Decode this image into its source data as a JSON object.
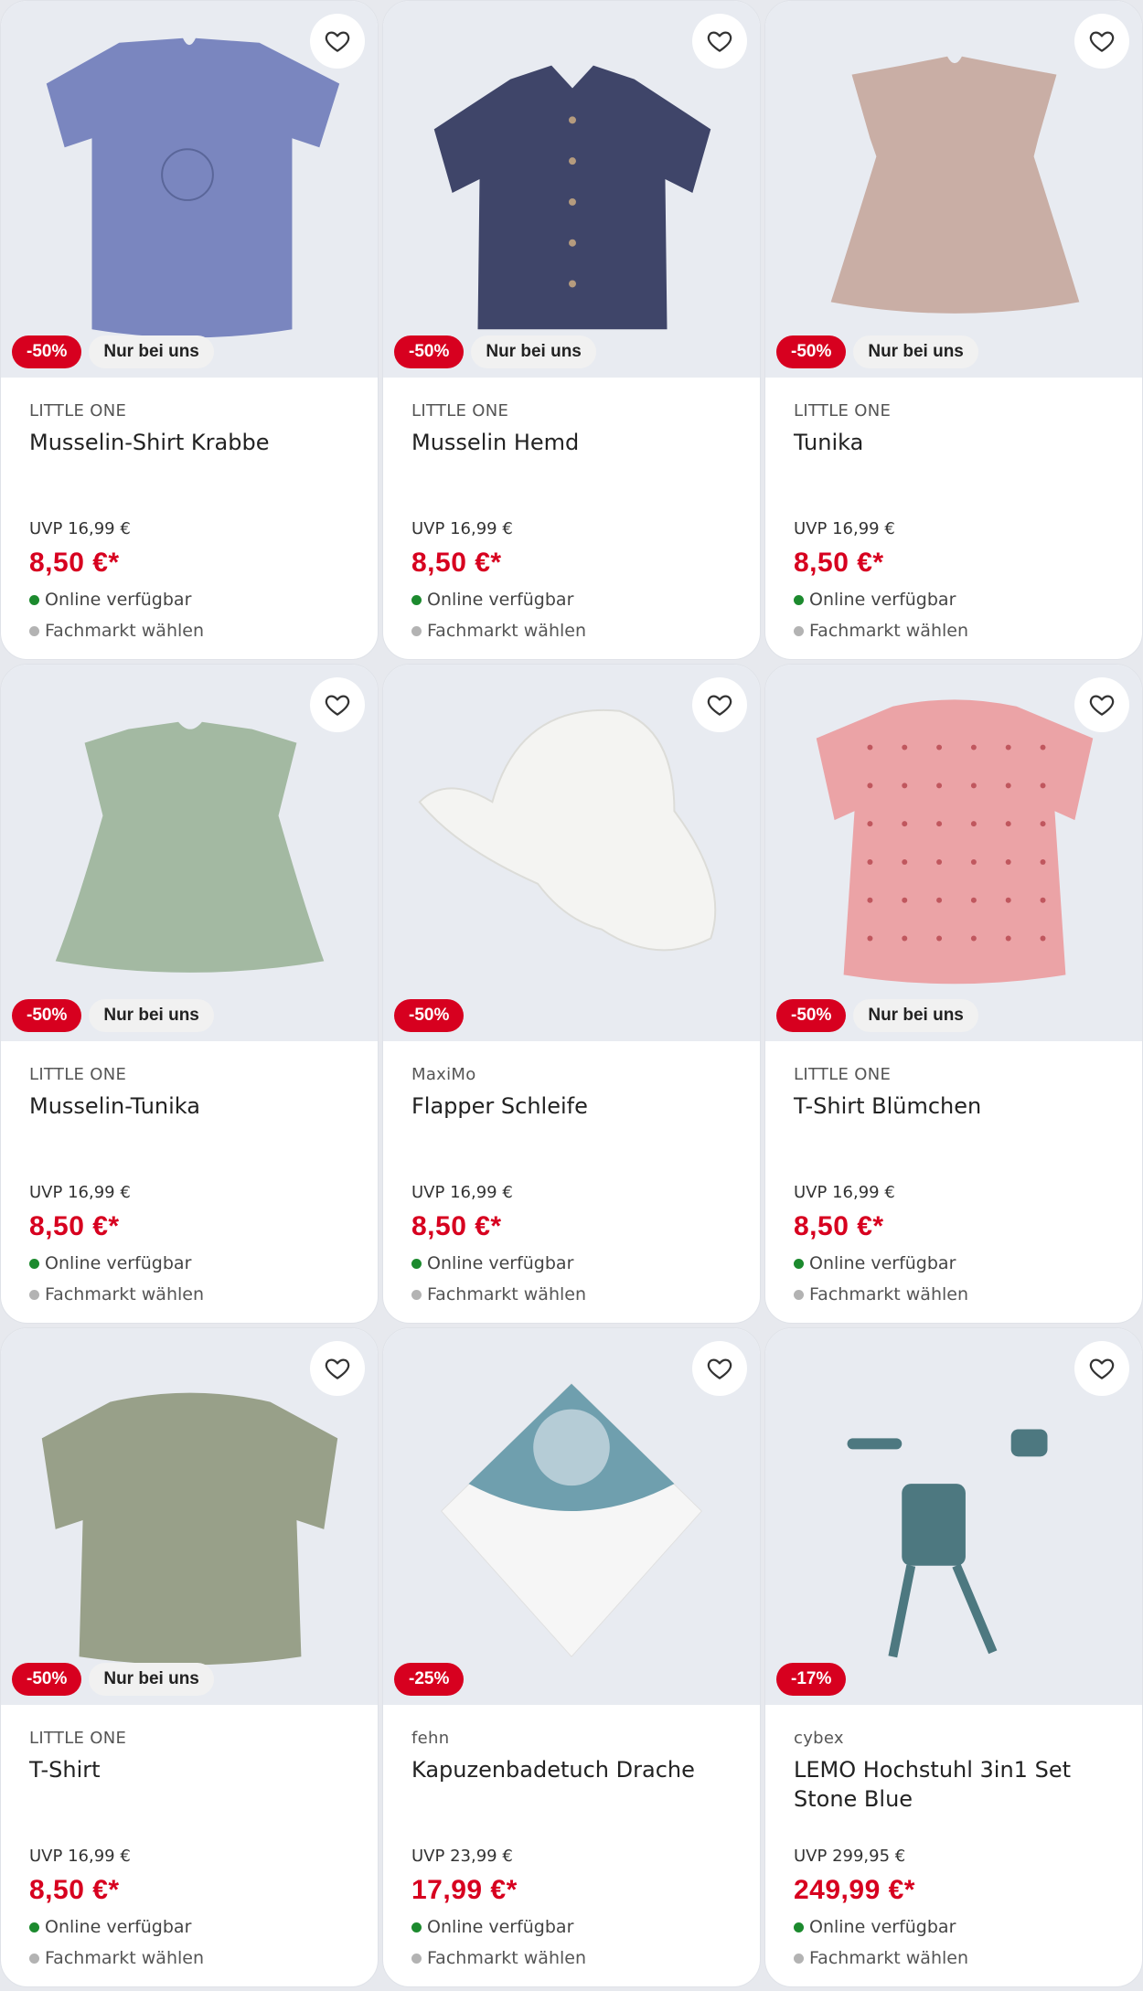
{
  "colors": {
    "accent": "#d7001f",
    "available": "#1c8a2e",
    "store_dot": "#b3b3b3",
    "image_bg": "#e8ebf1"
  },
  "products": [
    {
      "brand": "LITTLE ONE",
      "name": "Musselin-Shirt Krabbe",
      "uvp": "UVP 16,99 €",
      "price": "8,50 €*",
      "discount": "-50%",
      "exclusive": "Nur bei uns",
      "availability": "Online verfügbar",
      "store": "Fachmarkt wählen",
      "image_icon": "blue-shirt-crab",
      "color": "#7a86bf"
    },
    {
      "brand": "LITTLE ONE",
      "name": "Musselin Hemd",
      "uvp": "UVP 16,99 €",
      "price": "8,50 €*",
      "discount": "-50%",
      "exclusive": "Nur bei uns",
      "availability": "Online verfügbar",
      "store": "Fachmarkt wählen",
      "image_icon": "navy-button-shirt",
      "color": "#3f4569"
    },
    {
      "brand": "LITTLE ONE",
      "name": "Tunika",
      "uvp": "UVP 16,99 €",
      "price": "8,50 €*",
      "discount": "-50%",
      "exclusive": "Nur bei uns",
      "availability": "Online verfügbar",
      "store": "Fachmarkt wählen",
      "image_icon": "rose-tunic",
      "color": "#c9aea5"
    },
    {
      "brand": "LITTLE ONE",
      "name": "Musselin-Tunika",
      "uvp": "UVP 16,99 €",
      "price": "8,50 €*",
      "discount": "-50%",
      "exclusive": "Nur bei uns",
      "availability": "Online verfügbar",
      "store": "Fachmarkt wählen",
      "image_icon": "green-tunic",
      "color": "#a3b9a2"
    },
    {
      "brand": "MaxiMo",
      "name": "Flapper Schleife",
      "uvp": "UVP 16,99 €",
      "price": "8,50 €*",
      "discount": "-50%",
      "exclusive": "",
      "availability": "Online verfügbar",
      "store": "Fachmarkt wählen",
      "image_icon": "white-sun-hat",
      "color": "#f4f4f2"
    },
    {
      "brand": "LITTLE ONE",
      "name": "T-Shirt Blümchen",
      "uvp": "UVP 16,99 €",
      "price": "8,50 €*",
      "discount": "-50%",
      "exclusive": "Nur bei uns",
      "availability": "Online verfügbar",
      "store": "Fachmarkt wählen",
      "image_icon": "pink-floral-shirt",
      "color": "#eba3a6"
    },
    {
      "brand": "LITTLE ONE",
      "name": "T-Shirt",
      "uvp": "UVP 16,99 €",
      "price": "8,50 €*",
      "discount": "-50%",
      "exclusive": "Nur bei uns",
      "availability": "Online verfügbar",
      "store": "Fachmarkt wählen",
      "image_icon": "olive-tshirt",
      "color": "#98a089"
    },
    {
      "brand": "fehn",
      "name": "Kapuzenbadetuch Drache",
      "uvp": "UVP 23,99 €",
      "price": "17,99 €*",
      "discount": "-25%",
      "exclusive": "",
      "availability": "Online verfügbar",
      "store": "Fachmarkt wählen",
      "image_icon": "dragon-hooded-towel",
      "color": "#6f9fae"
    },
    {
      "brand": "cybex",
      "name": "LEMO Hochstuhl 3in1 Set Stone Blue",
      "uvp": "UVP 299,95 €",
      "price": "249,99 €*",
      "discount": "-17%",
      "exclusive": "",
      "availability": "Online verfügbar",
      "store": "Fachmarkt wählen",
      "image_icon": "high-chair",
      "color": "#4d7880"
    }
  ]
}
